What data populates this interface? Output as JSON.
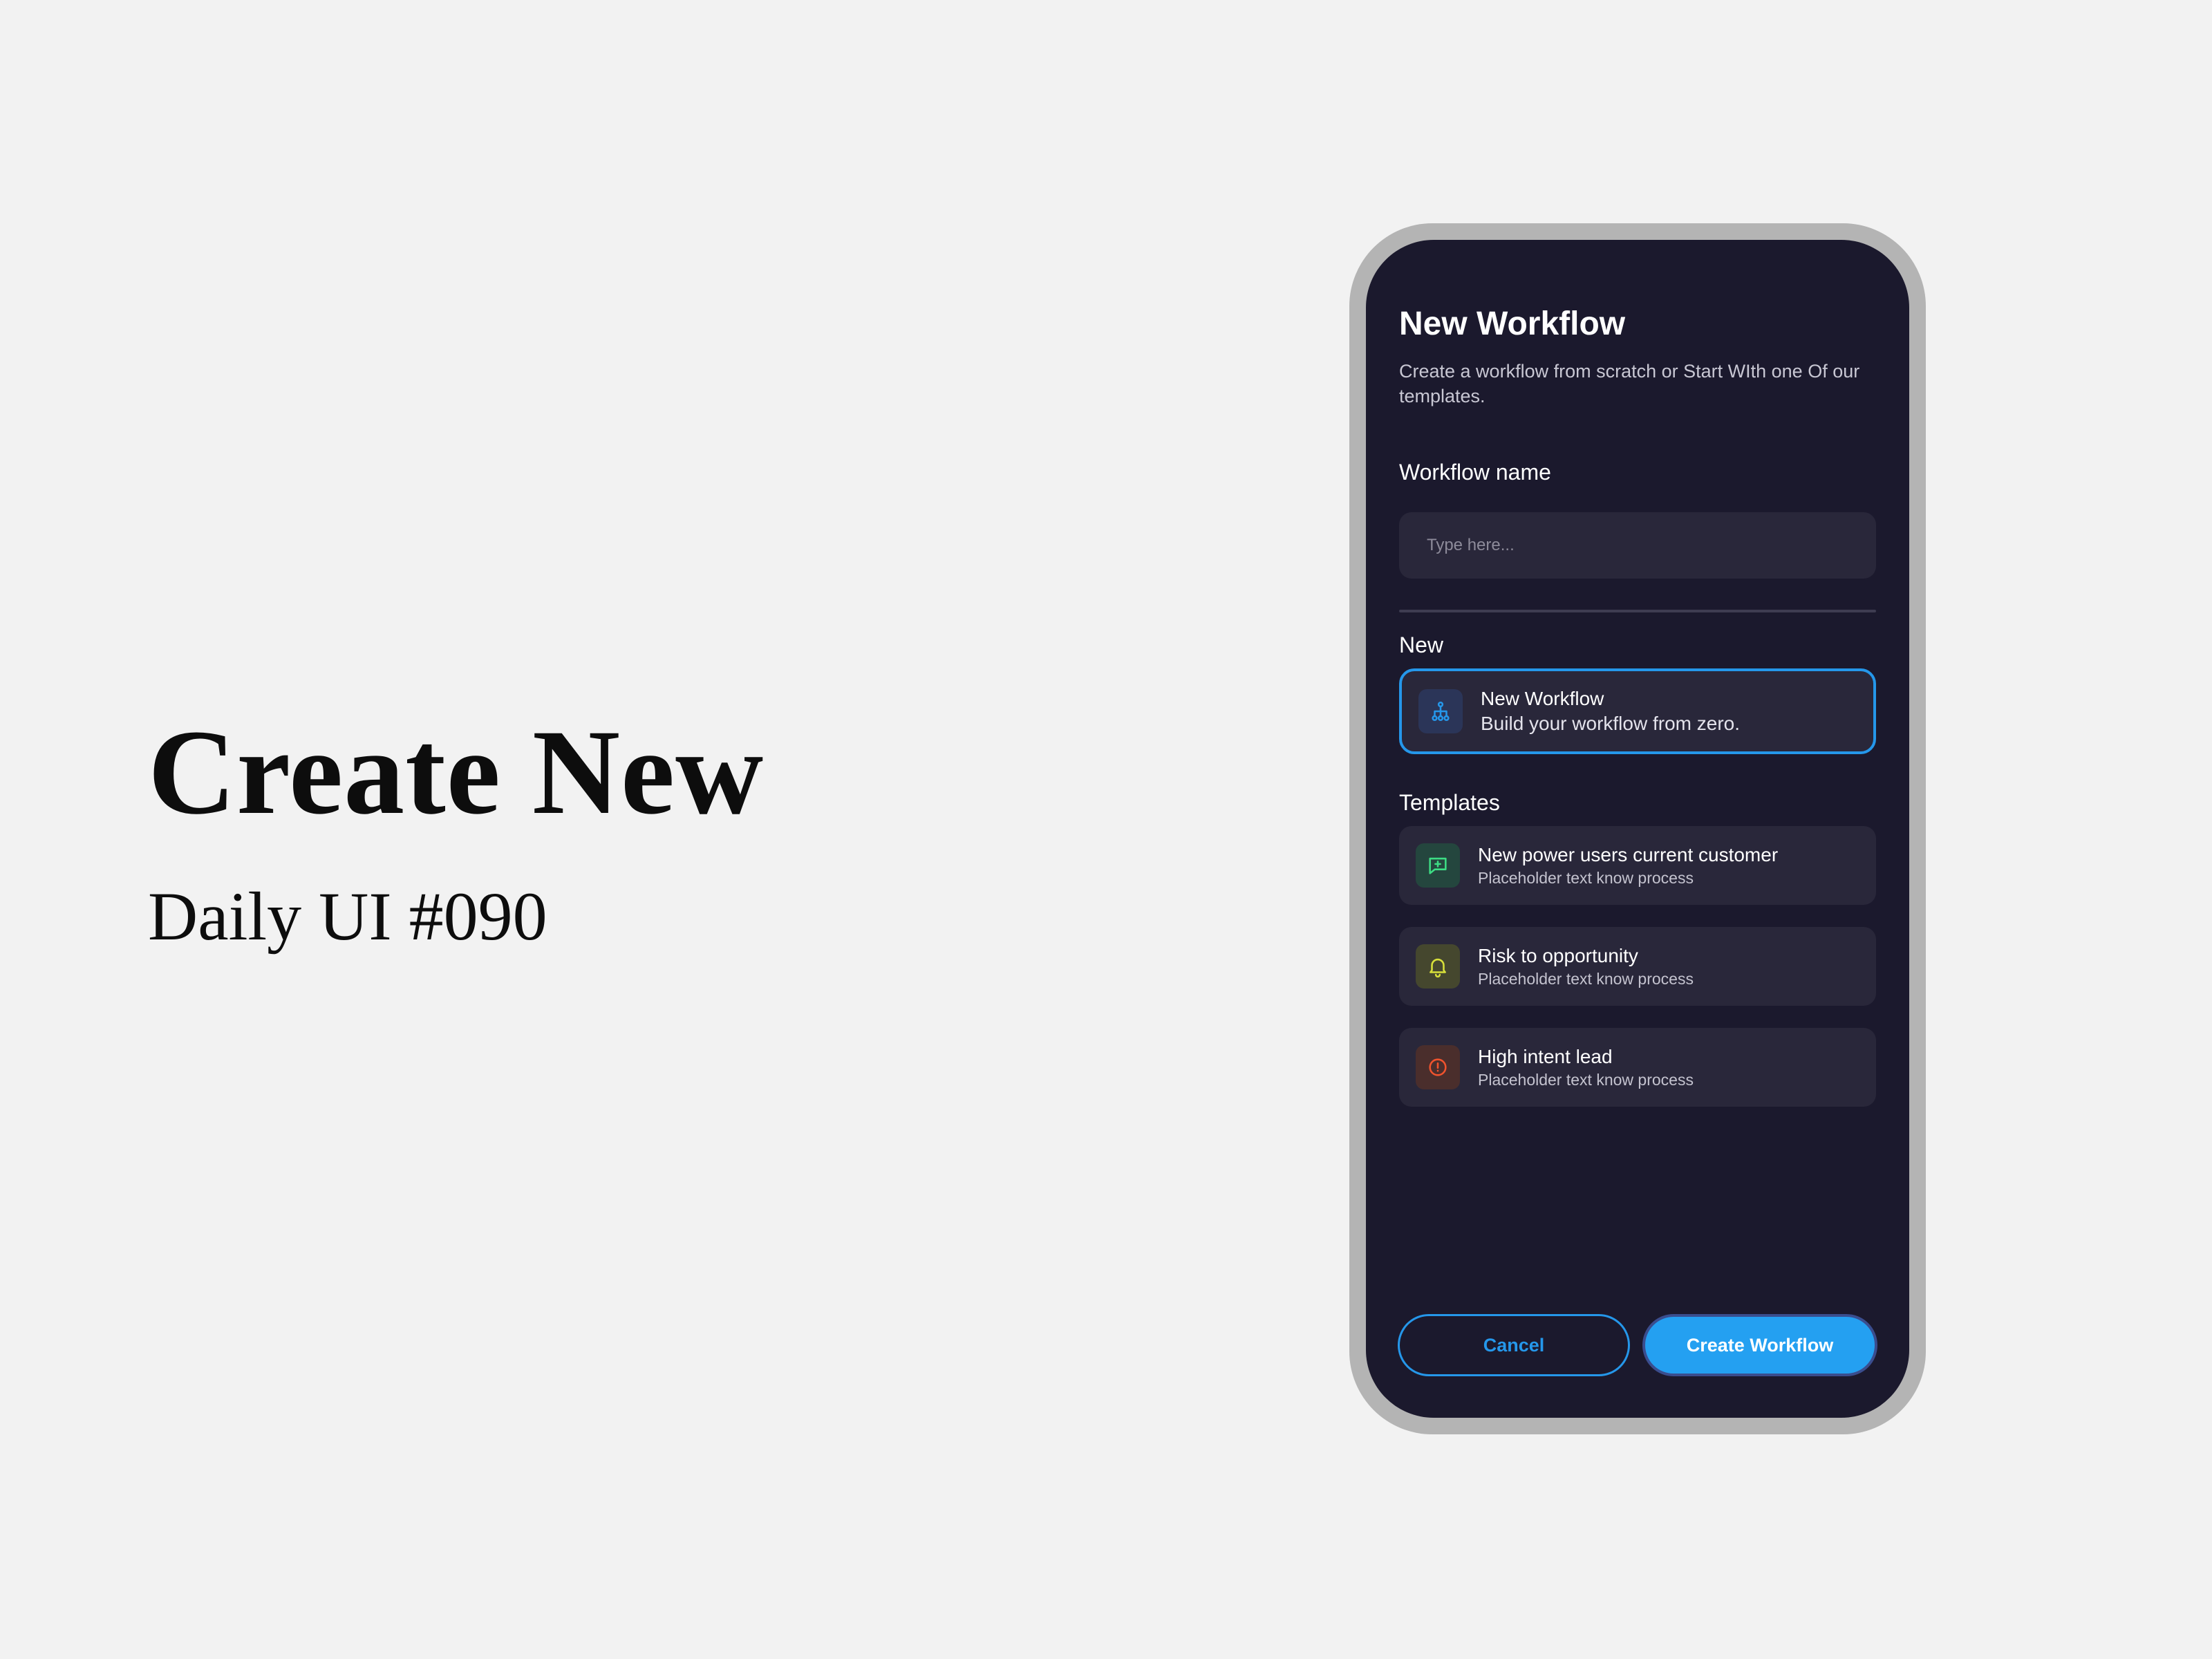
{
  "hero": {
    "title": "Create New",
    "subtitle": "Daily UI #090"
  },
  "screen": {
    "title": "New Workflow",
    "description": "Create a workflow from scratch or Start WIth one Of our templates.",
    "name_field": {
      "label": "Workflow name",
      "placeholder": "Type here...",
      "value": ""
    },
    "new_section": {
      "label": "New",
      "card": {
        "title": "New Workflow",
        "subtitle": "Build your workflow from zero.",
        "icon": "sitemap-icon",
        "icon_color": "#2597ea",
        "selected": true
      }
    },
    "templates_section": {
      "label": "Templates",
      "items": [
        {
          "title": "New power users current customer",
          "subtitle": "Placeholder text know process",
          "icon": "message-plus-icon",
          "icon_color": "#3ddc84"
        },
        {
          "title": "Risk to opportunity",
          "subtitle": "Placeholder text know process",
          "icon": "bell-icon",
          "icon_color": "#d8e03a"
        },
        {
          "title": "High intent lead",
          "subtitle": "Placeholder text know process",
          "icon": "alert-circle-icon",
          "icon_color": "#f0532d"
        }
      ]
    },
    "actions": {
      "cancel": "Cancel",
      "create": "Create Workflow"
    }
  },
  "colors": {
    "page_background": "#f2f2f2",
    "screen_background": "#1b192d",
    "card_background": "#29273a",
    "accent": "#2597ea",
    "primary_button": "#24a0f1"
  }
}
